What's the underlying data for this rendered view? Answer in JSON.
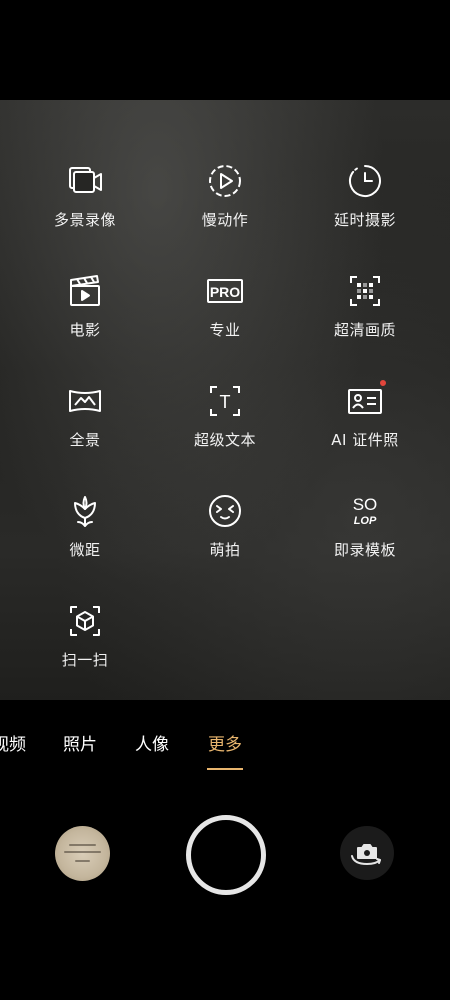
{
  "modes": [
    {
      "label": "多景录像",
      "icon": "multi-scene-video-icon"
    },
    {
      "label": "慢动作",
      "icon": "slow-motion-icon"
    },
    {
      "label": "延时摄影",
      "icon": "time-lapse-icon"
    },
    {
      "label": "电影",
      "icon": "movie-clapper-icon"
    },
    {
      "label": "专业",
      "icon": "pro-icon",
      "icon_text": "PRO"
    },
    {
      "label": "超清画质",
      "icon": "high-resolution-icon"
    },
    {
      "label": "全景",
      "icon": "panorama-icon"
    },
    {
      "label": "超级文本",
      "icon": "super-text-icon",
      "icon_text": "T"
    },
    {
      "label": "AI 证件照",
      "icon": "id-photo-icon",
      "badge": "new-dot"
    },
    {
      "label": "微距",
      "icon": "macro-flower-icon"
    },
    {
      "label": "萌拍",
      "icon": "cute-face-icon"
    },
    {
      "label": "即录模板",
      "icon": "solop-template-icon",
      "icon_text": "SO",
      "icon_text2": "LOP"
    },
    {
      "label": "扫一扫",
      "icon": "scan-icon"
    }
  ],
  "tabs": [
    {
      "label": "视频",
      "active": false
    },
    {
      "label": "照片",
      "active": false
    },
    {
      "label": "人像",
      "active": false
    },
    {
      "label": "更多",
      "active": true
    }
  ],
  "controls": {
    "gallery_thumbnail": "gallery-thumbnail",
    "shutter": "shutter-button",
    "flip": "switch-camera-icon"
  },
  "colors": {
    "accent": "#e8b56e",
    "badge": "#e2453b",
    "background": "#000000",
    "shutter_ring": "#e6e6e6"
  }
}
